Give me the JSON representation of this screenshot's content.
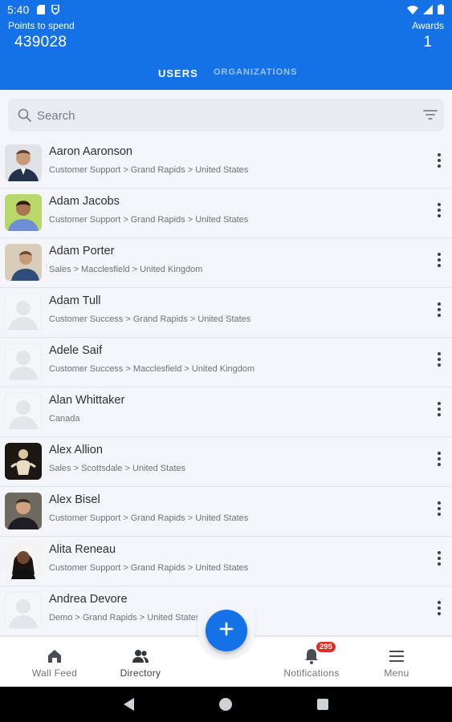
{
  "status_bar": {
    "time": "5:40",
    "left_icons": [
      "sd-card-icon",
      "shield-icon"
    ],
    "right_icons": [
      "wifi-icon",
      "signal-icon",
      "battery-icon"
    ]
  },
  "header": {
    "points_label": "Points to spend",
    "points_value": "439028",
    "awards_label": "Awards",
    "awards_value": "1",
    "tabs": [
      {
        "label": "USERS",
        "active": true
      },
      {
        "label": "ORGANIZATIONS",
        "active": false
      }
    ],
    "accent_color": "#1472e6"
  },
  "search": {
    "placeholder": "Search",
    "value": ""
  },
  "users": [
    {
      "name": "Aaron Aaronson",
      "subtitle": "Customer Support > Grand Rapids > United States",
      "avatar": "photo"
    },
    {
      "name": "Adam Jacobs",
      "subtitle": "Customer Support > Grand Rapids > United States",
      "avatar": "photo"
    },
    {
      "name": "Adam Porter",
      "subtitle": "Sales > Macclesfield > United Kingdom",
      "avatar": "photo"
    },
    {
      "name": "Adam Tull",
      "subtitle": "Customer Success > Grand Rapids > United States",
      "avatar": "placeholder"
    },
    {
      "name": "Adele Saif",
      "subtitle": "Customer Success > Macclesfield > United Kingdom",
      "avatar": "placeholder"
    },
    {
      "name": "Alan Whittaker",
      "subtitle": "Canada",
      "avatar": "placeholder"
    },
    {
      "name": "Alex Allion",
      "subtitle": "Sales > Scottsdale > United States",
      "avatar": "photo"
    },
    {
      "name": "Alex Bisel",
      "subtitle": "Customer Support > Grand Rapids > United States",
      "avatar": "photo"
    },
    {
      "name": "Alita Reneau",
      "subtitle": "Customer Support > Grand Rapids > United States",
      "avatar": "photo"
    },
    {
      "name": "Andrea Devore",
      "subtitle": "Demo > Grand Rapids > United States",
      "avatar": "placeholder"
    }
  ],
  "bottom_nav": {
    "items": [
      {
        "label": "Wall Feed",
        "icon": "home-icon"
      },
      {
        "label": "Directory",
        "icon": "people-icon"
      },
      {
        "label": "Notifications",
        "icon": "bell-icon"
      },
      {
        "label": "Menu",
        "icon": "hamburger-icon"
      }
    ],
    "notification_badge": "295",
    "fab_icon": "plus-icon"
  },
  "system_nav": {
    "icons": [
      "back-icon",
      "home-circle-icon",
      "recents-icon"
    ]
  }
}
